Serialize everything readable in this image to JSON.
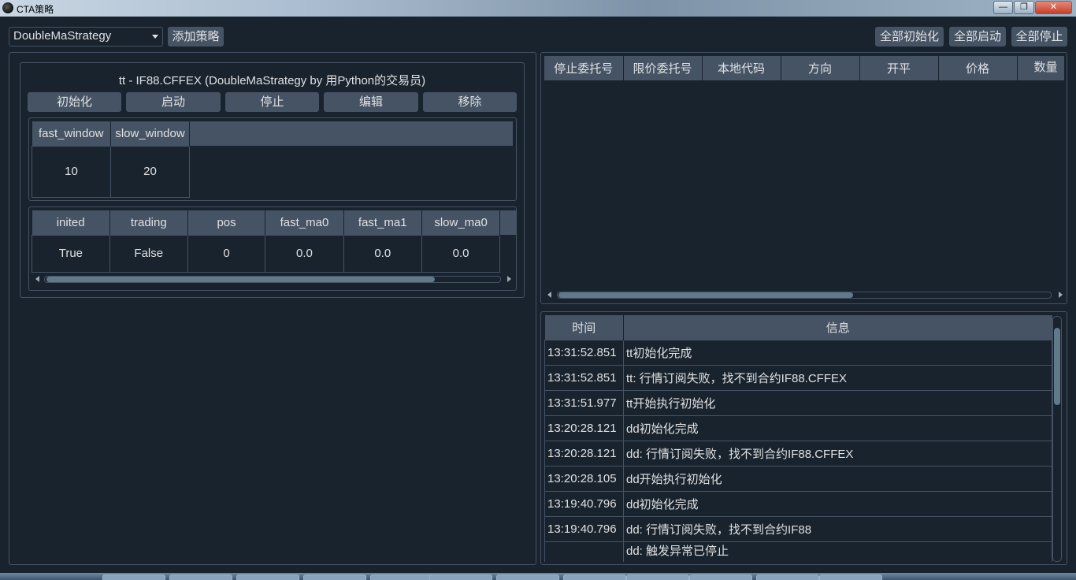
{
  "window": {
    "title": "CTA策略",
    "min_glyph": "—",
    "max_glyph": "❐",
    "close_glyph": "✕"
  },
  "toolbar": {
    "strategy_class": "DoubleMaStrategy",
    "add_strategy": "添加策略",
    "init_all": "全部初始化",
    "start_all": "全部启动",
    "stop_all": "全部停止"
  },
  "strategy": {
    "title": "tt  -  IF88.CFFEX  (DoubleMaStrategy by 用Python的交易员)",
    "buttons": {
      "init": "初始化",
      "start": "启动",
      "stop": "停止",
      "edit": "编辑",
      "remove": "移除"
    },
    "params": {
      "headers": [
        "fast_window",
        "slow_window"
      ],
      "values": [
        "10",
        "20"
      ]
    },
    "variables": {
      "headers": [
        "inited",
        "trading",
        "pos",
        "fast_ma0",
        "fast_ma1",
        "slow_ma0"
      ],
      "values": [
        "True",
        "False",
        "0",
        "0.0",
        "0.0",
        "0.0"
      ]
    }
  },
  "stop_orders": {
    "headers": [
      "停止委托号",
      "限价委托号",
      "本地代码",
      "方向",
      "开平",
      "价格",
      "数量"
    ]
  },
  "log": {
    "headers": [
      "时间",
      "信息"
    ],
    "rows": [
      {
        "time": "13:31:52.851",
        "msg": "tt初始化完成"
      },
      {
        "time": "13:31:52.851",
        "msg": "tt: 行情订阅失败，找不到合约IF88.CFFEX"
      },
      {
        "time": "13:31:51.977",
        "msg": "tt开始执行初始化"
      },
      {
        "time": "13:20:28.121",
        "msg": "dd初始化完成"
      },
      {
        "time": "13:20:28.121",
        "msg": "dd: 行情订阅失败，找不到合约IF88.CFFEX"
      },
      {
        "time": "13:20:28.105",
        "msg": "dd开始执行初始化"
      },
      {
        "time": "13:19:40.796",
        "msg": "dd初始化完成"
      },
      {
        "time": "13:19:40.796",
        "msg": "dd: 行情订阅失败，找不到合约IF88"
      },
      {
        "time": "",
        "msg": "dd: 触发异常已停止"
      }
    ]
  }
}
